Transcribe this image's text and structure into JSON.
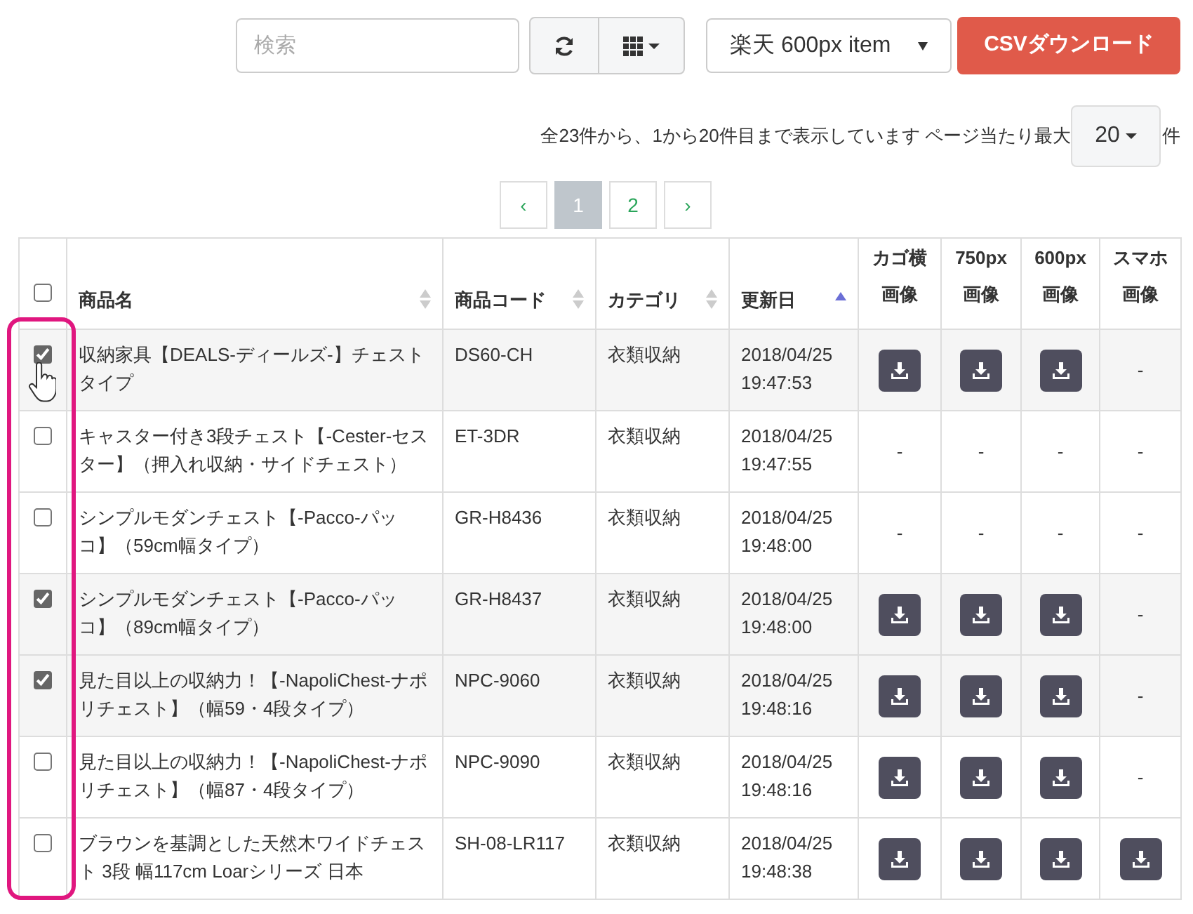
{
  "toolbar": {
    "search": {
      "placeholder": "検索"
    },
    "view_select": {
      "value": "楽天 600px item"
    },
    "csv_button": "CSVダウンロード"
  },
  "pagination_info": {
    "text": "全23件から、1から20件目まで表示しています ページ当たり最大",
    "page_size": "20",
    "unit": "件"
  },
  "pagination": [
    {
      "label": "‹",
      "selected": false
    },
    {
      "label": "1",
      "selected": true
    },
    {
      "label": "2",
      "selected": false
    },
    {
      "label": "›",
      "selected": false
    }
  ],
  "table": {
    "select_all": {
      "checked": false
    },
    "columns": [
      {
        "label": "商品名",
        "sortable": true,
        "sorted": false
      },
      {
        "label": "商品コード",
        "sortable": true,
        "sorted": false
      },
      {
        "label": "カテゴリ",
        "sortable": true,
        "sorted": false
      },
      {
        "label": "更新日",
        "sortable": true,
        "sorted": true
      },
      {
        "label": "カゴ横画像",
        "sortable": false
      },
      {
        "label": "750px画像",
        "sortable": false
      },
      {
        "label": "600px画像",
        "sortable": false
      },
      {
        "label": "スマホ画像",
        "sortable": false
      }
    ],
    "rows": [
      {
        "checked": true,
        "name": "収納家具【DEALS-ディールズ-】チェストタイプ",
        "code": "DS60-CH",
        "category": "衣類収納",
        "updated": "2018/04/25 19:47:53",
        "images": [
          {
            "kind": "download"
          },
          {
            "kind": "download"
          },
          {
            "kind": "download"
          },
          {
            "kind": "empty",
            "text": "-"
          }
        ]
      },
      {
        "checked": false,
        "name": "キャスター付き3段チェスト【-Cester-セスター】（押入れ収納・サイドチェスト）",
        "code": "ET-3DR",
        "category": "衣類収納",
        "updated": "2018/04/25 19:47:55",
        "images": [
          {
            "kind": "empty",
            "text": "-"
          },
          {
            "kind": "empty",
            "text": "-"
          },
          {
            "kind": "empty",
            "text": "-"
          },
          {
            "kind": "empty",
            "text": "-"
          }
        ]
      },
      {
        "checked": false,
        "name": "シンプルモダンチェスト【-Pacco-パッコ】（59cm幅タイプ）",
        "code": "GR-H8436",
        "category": "衣類収納",
        "updated": "2018/04/25 19:48:00",
        "images": [
          {
            "kind": "empty",
            "text": "-"
          },
          {
            "kind": "empty",
            "text": "-"
          },
          {
            "kind": "empty",
            "text": "-"
          },
          {
            "kind": "empty",
            "text": "-"
          }
        ]
      },
      {
        "checked": true,
        "name": "シンプルモダンチェスト【-Pacco-パッコ】（89cm幅タイプ）",
        "code": "GR-H8437",
        "category": "衣類収納",
        "updated": "2018/04/25 19:48:00",
        "images": [
          {
            "kind": "download"
          },
          {
            "kind": "download"
          },
          {
            "kind": "download"
          },
          {
            "kind": "empty",
            "text": "-"
          }
        ]
      },
      {
        "checked": true,
        "name": "見た目以上の収納力！【-NapoliChest-ナポリチェスト】（幅59・4段タイプ）",
        "code": "NPC-9060",
        "category": "衣類収納",
        "updated": "2018/04/25 19:48:16",
        "images": [
          {
            "kind": "download"
          },
          {
            "kind": "download"
          },
          {
            "kind": "download"
          },
          {
            "kind": "empty",
            "text": "-"
          }
        ]
      },
      {
        "checked": false,
        "name": "見た目以上の収納力！【-NapoliChest-ナポリチェスト】（幅87・4段タイプ）",
        "code": "NPC-9090",
        "category": "衣類収納",
        "updated": "2018/04/25 19:48:16",
        "images": [
          {
            "kind": "download"
          },
          {
            "kind": "download"
          },
          {
            "kind": "download"
          },
          {
            "kind": "empty",
            "text": "-"
          }
        ]
      },
      {
        "checked": false,
        "name": "ブラウンを基調とした天然木ワイドチェスト 3段 幅117cm Loarシリーズ 日本",
        "code": "SH-08-LR117",
        "category": "衣類収納",
        "updated": "2018/04/25 19:48:38",
        "images": [
          {
            "kind": "download"
          },
          {
            "kind": "download"
          },
          {
            "kind": "download"
          },
          {
            "kind": "download"
          }
        ]
      }
    ]
  }
}
